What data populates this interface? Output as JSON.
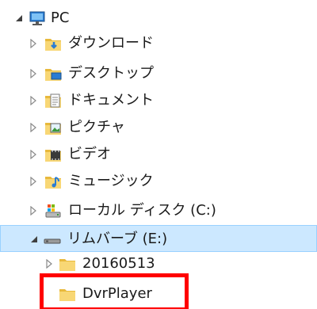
{
  "tree": {
    "root": {
      "label": "PC",
      "icon": "pc-monitor-icon",
      "expanded": true
    },
    "pc_children": [
      {
        "label": "ダウンロード",
        "icon": "downloads-folder-icon"
      },
      {
        "label": "デスクトップ",
        "icon": "desktop-folder-icon"
      },
      {
        "label": "ドキュメント",
        "icon": "documents-folder-icon"
      },
      {
        "label": "ピクチャ",
        "icon": "pictures-folder-icon"
      },
      {
        "label": "ビデオ",
        "icon": "videos-folder-icon"
      },
      {
        "label": "ミュージック",
        "icon": "music-folder-icon"
      },
      {
        "label": "ローカル ディスク (C:)",
        "icon": "local-disk-icon"
      },
      {
        "label": "リムバーブ (E:)",
        "icon": "removable-drive-icon",
        "expanded": true,
        "selected": true
      }
    ],
    "drive_children": [
      {
        "label": "20160513",
        "icon": "folder-icon"
      },
      {
        "label": "DvrPlayer",
        "icon": "folder-icon",
        "highlighted": true
      }
    ]
  },
  "colors": {
    "selection_bg": "#cce8ff",
    "selection_border": "#99d1ff",
    "highlight_border": "#ff0000",
    "folder_yellow": "#f8d775"
  }
}
